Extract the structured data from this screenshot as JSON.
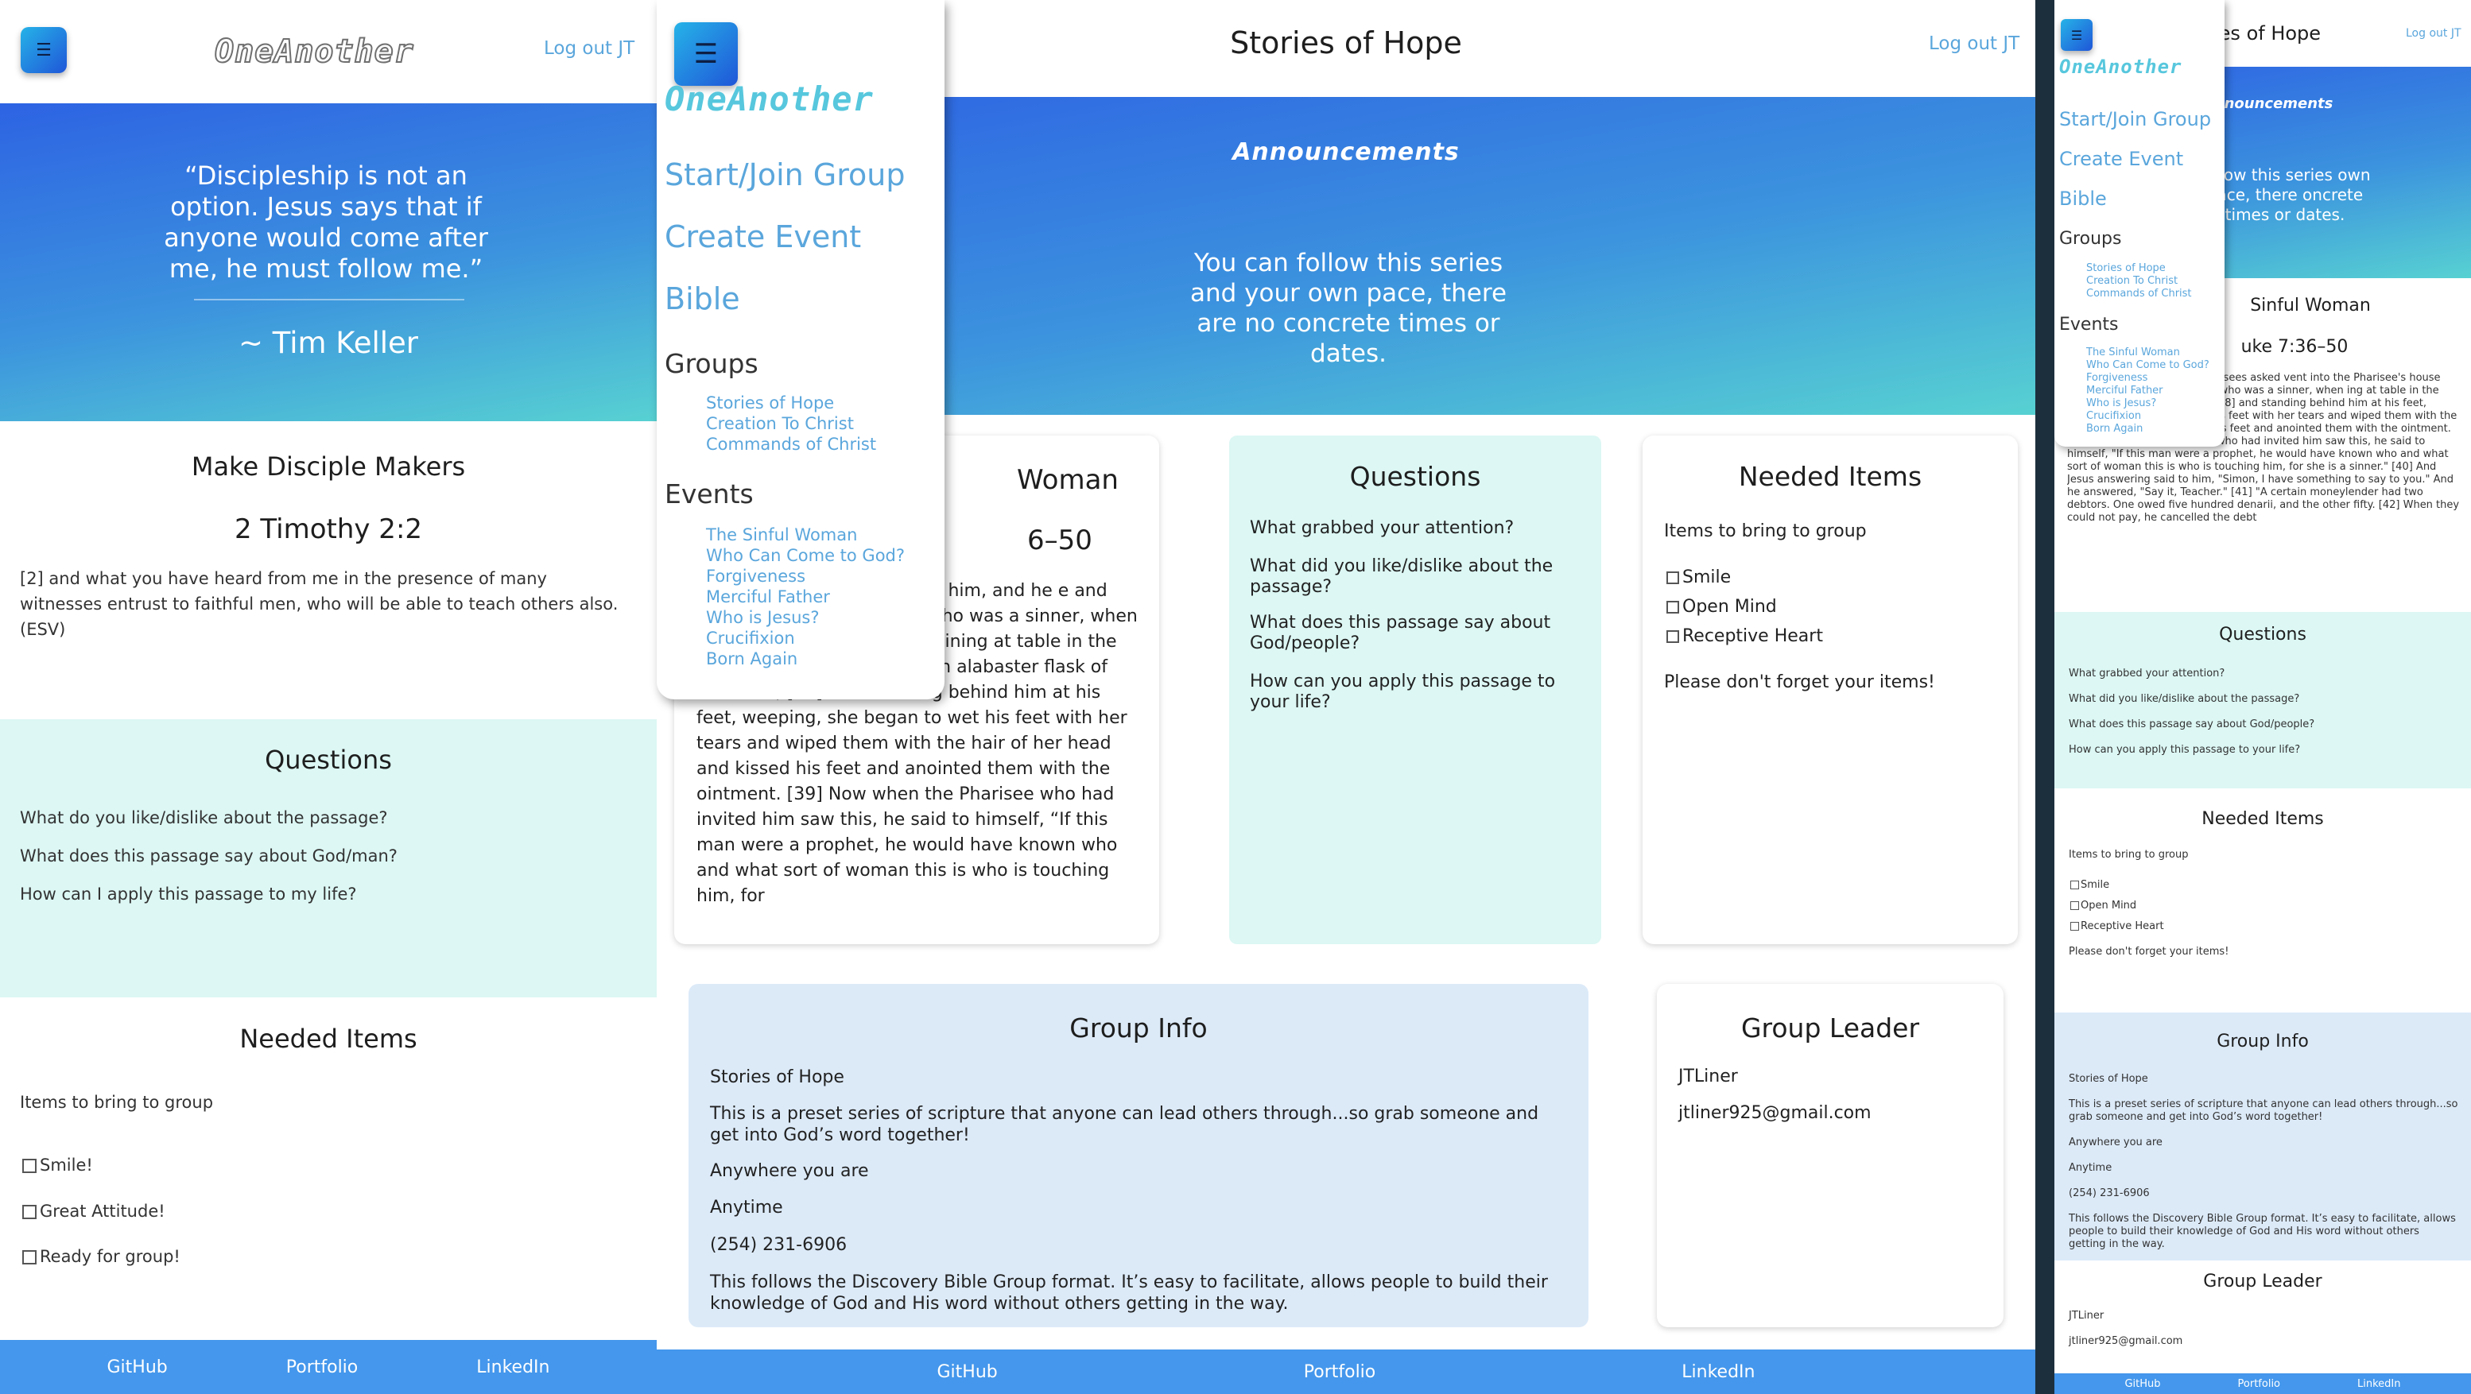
{
  "app": {
    "logo": "OneAnother",
    "logout": "Log out JT"
  },
  "left": {
    "quote": "“Discipleship is not an option. Jesus says that if anyone would come after me, he must follow me.”",
    "quote_author": "~ Tim Keller",
    "disciple": {
      "title": "Make Disciple Makers",
      "reference": "2 Timothy 2:2",
      "text": "[2] and what you have heard from me in the presence of many witnesses entrust to faithful men, who will be able to teach others also. (ESV)"
    },
    "questions": {
      "title": "Questions",
      "items": [
        "What do you like/dislike about the passage?",
        "What does this passage say about God/man?",
        "How can I apply this passage to my life?"
      ]
    },
    "needed": {
      "title": "Needed Items",
      "intro": "Items to bring to group",
      "items": [
        "Smile!",
        "Great Attitude!",
        "Ready for group!"
      ]
    }
  },
  "center": {
    "page_title": "Stories of Hope",
    "announcements": {
      "title": "Announcements",
      "text": "You can follow this series and your own pace, there are no concrete times or dates."
    },
    "story": {
      "title": "Woman",
      "reference": "6–50",
      "text": "Forgiven [36] One of at with him, and he e and reclined at table. the city, who was a sinner, when she learned that he was reclining at table in the Pharisee's house, brought an alabaster flask of ointment, [38] and standing behind him at his feet, weeping, she began to wet his feet with her tears and wiped them with the hair of her head and kissed his feet and anointed them with the ointment. [39] Now when the Pharisee who had invited him saw this, he said to himself, “If this man were a prophet, he would have known who and what sort of woman this is who is touching him, for"
    },
    "questions": {
      "title": "Questions",
      "items": [
        "What grabbed your attention?",
        "What did you like/dislike about the passage?",
        "What does this passage say about God/people?",
        "How can you apply this passage to your life?"
      ]
    },
    "needed": {
      "title": "Needed Items",
      "intro": "Items to bring to group",
      "items": [
        "Smile",
        "Open Mind",
        "Receptive Heart"
      ],
      "outro": "Please don't forget your items!"
    },
    "group_info": {
      "title": "Group Info",
      "name": "Stories of Hope",
      "description": "This is a preset series of scripture that anyone can lead others through...so grab someone and get into God’s word together!",
      "location": "Anywhere you are",
      "time": "Anytime",
      "phone": "(254) 231-6906",
      "format": "This follows the Discovery Bible Group format. It’s easy to facilitate, allows people to build their knowledge of God and His word without others getting in the way."
    },
    "group_leader": {
      "title": "Group Leader",
      "name": "JTLiner",
      "email": "jtliner925@gmail.com"
    }
  },
  "menu": {
    "main": [
      "Start/Join Group",
      "Create Event",
      "Bible"
    ],
    "groups_heading": "Groups",
    "groups": [
      "Stories of Hope",
      "Creation To Christ",
      "Commands of Christ"
    ],
    "events_heading": "Events",
    "events": [
      "The Sinful Woman",
      "Who Can Come to God?",
      "Forgiveness",
      "Merciful Father",
      "Who is Jesus?",
      "Crucifixion",
      "Born Again"
    ]
  },
  "right": {
    "title_partial": "ies of Hope",
    "announcement_partial": "nouncements",
    "announcement_text": "follow this series own pace, there oncrete times or dates.",
    "story_title": "Sinful Woman",
    "story_ref": "uke 7:36–50",
    "story_text": "Forgiven [36] One of the Pharisees asked vent into the Pharisee's house and reclined man of the city, who was a sinner, when ing at table in the Pharisee's house, ointment, [38] and standing behind him at his feet, weeping, she began to wet his feet with her tears and wiped them with the hair of her head and kissed his feet and anointed them with the ointment. [39] Now when the Pharisee who had invited him saw this, he said to himself, \"If this man were a prophet, he would have known who and what sort of woman this is who is touching him, for she is a sinner.\" [40] And Jesus answering said to him, \"Simon, I have something to say to you.\" And he answered, \"Say it, Teacher.\" [41] \"A certain moneylender had two debtors. One owed five hundred denarii, and the other fifty. [42] When they could not pay, he cancelled the debt"
  },
  "footer": {
    "links": [
      "GitHub",
      "Portfolio",
      "LinkedIn"
    ]
  },
  "colors": {
    "accent": "#4497ec",
    "link": "#5aa6dc",
    "mint": "#dcf7f4",
    "pale_blue": "#dceaf8"
  },
  "icons": {
    "menu": "hamburger-icon",
    "checkbox": "checkbox-icon"
  }
}
